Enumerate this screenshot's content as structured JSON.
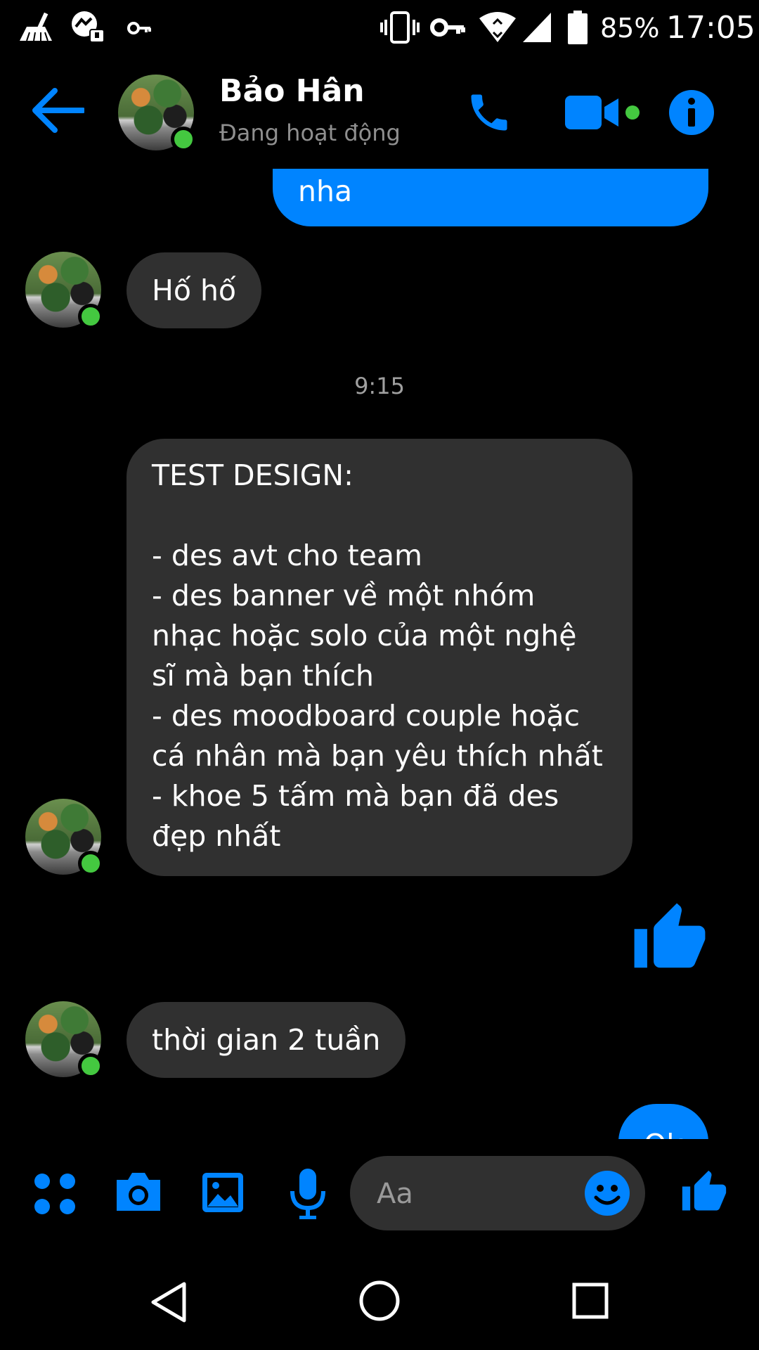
{
  "status_bar": {
    "battery": "85%",
    "time": "17:05"
  },
  "header": {
    "name": "Bảo Hân",
    "status": "Đang hoạt động"
  },
  "messages": {
    "sent_partial": "nha",
    "msg_1": "Hố hố",
    "time_sep": "9:15",
    "msg_2": "TEST DESIGN:\n\n- des avt cho team\n- des banner về một nhóm\nnhạc hoặc solo của một nghệ\nsĩ mà bạn thích\n- des moodboard couple hoặc\ncá nhân mà bạn yêu thích nhất\n- khoe 5 tấm mà bạn đã des\nđẹp nhất",
    "msg_3": "thời gian 2 tuần",
    "sent_ok": "Ok"
  },
  "composer": {
    "placeholder": "Aa"
  },
  "colors": {
    "accent": "#0084ff",
    "incoming_bubble": "#303030",
    "online": "#44c840"
  }
}
